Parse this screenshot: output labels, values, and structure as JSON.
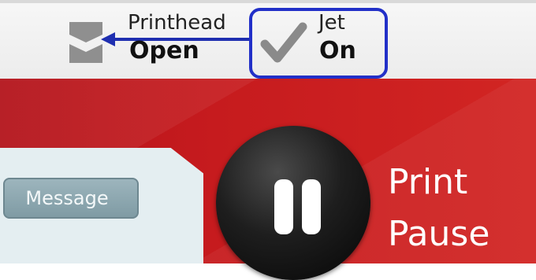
{
  "status_bar": {
    "printhead": {
      "label": "Printhead",
      "value": "Open",
      "icon": "printhead-icon"
    },
    "jet": {
      "label": "Jet",
      "value": "On",
      "icon": "checkmark-icon"
    },
    "colors": {
      "highlight_border": "#2230c8",
      "arrow": "#1f2fb0"
    }
  },
  "main": {
    "message_button": "Message",
    "print_pause": {
      "line1": "Print",
      "line2": "Pause",
      "icon": "pause-icon"
    },
    "colors": {
      "background": "#c61b1e",
      "panel": "#e4eef1",
      "button": "#8ea9b1"
    }
  }
}
